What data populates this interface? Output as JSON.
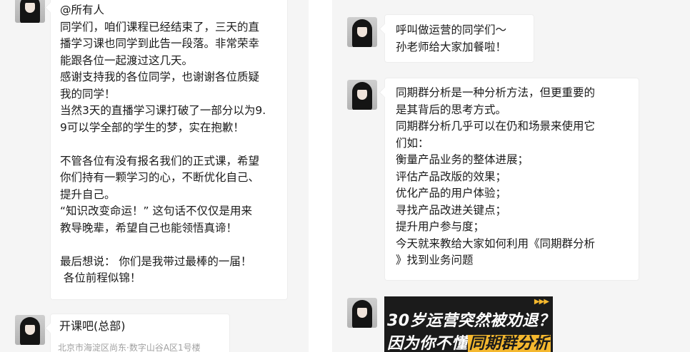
{
  "left_chat": {
    "message_lines": [
      "@所有人",
      "同学们，咱们课程已经结束了，三天的直",
      "播学习课也同学到此告一段落。非常荣幸",
      "能跟各位一起渡过这几天。",
      "感谢支持我的各位同学，也谢谢各位质疑",
      "我的同学！",
      "当然3天的直播学习课打破了一部分以为9.",
      "9可以学全部的学生的梦，实在抱歉！",
      "",
      "不管各位有没有报名我们的正式课，希望",
      "你们持有一颗学习的心，不断优化自己、",
      "提升自己。",
      "“知识改变命运！” 这句话不仅仅是用来",
      "教导晚辈，希望自己也能领悟真谛！",
      "",
      "最后想说： 你们是我带过最棒的一届！",
      " 各位前程似锦！"
    ],
    "location_card": {
      "name": "开课吧(总部)",
      "address": "北京市海淀区尚东·数字山谷A区1号楼"
    }
  },
  "right_chat": {
    "msg_yunying_lines": [
      "呼叫做运营的同学们～",
      "孙老师给大家加餐啦！"
    ],
    "msg_cohort_lines": [
      "同期群分析是一种分析方法，但更重要的",
      "是其背后的思考方式。",
      "同期群分析几乎可以在仍和场景来使用它",
      "们如：",
      "衡量产品业务的整体进展；",
      "评估产品改版的效果；",
      "优化产品的用户体验；",
      "寻找产品改进关键点；",
      "提升用户参与度；",
      "今天就来教给大家如何利用《同期群分析",
      "》找到业务问题"
    ],
    "banner": {
      "line1": "30岁运营突然被劝退？",
      "line2_prefix": "因为你不懂",
      "line2_highlight": "同期群分析"
    }
  },
  "colors": {
    "panel_background": "#f5f5f5",
    "bubble_background": "#ffffff",
    "text": "#1a1a1a",
    "address_text": "#a0a0a0",
    "banner_background": "#1b1b1b",
    "banner_highlight": "#f5b82e"
  },
  "icons": {
    "banner_arrows": "▶▶▶"
  }
}
